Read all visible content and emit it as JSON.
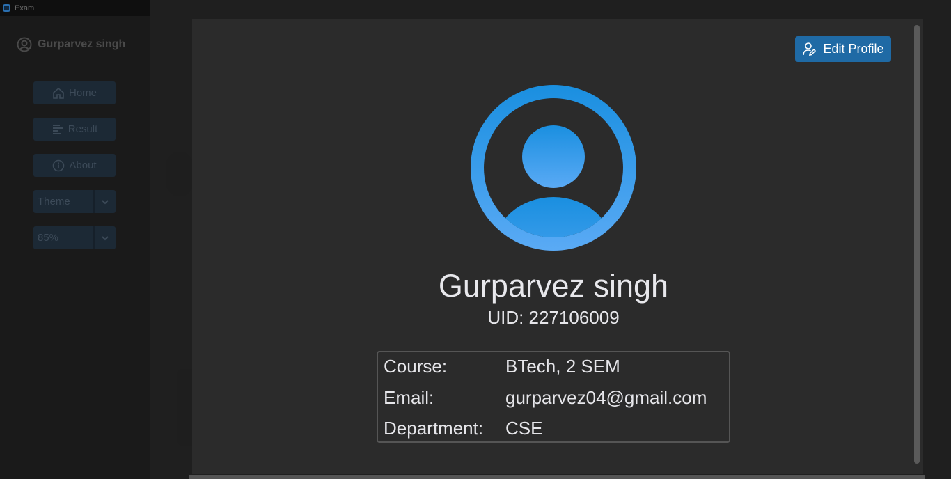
{
  "window": {
    "title": "Exam"
  },
  "sidebar": {
    "user_name": "Gurparvez singh",
    "nav": [
      {
        "label": "Home",
        "icon": "home-icon"
      },
      {
        "label": "Result",
        "icon": "chart-icon"
      },
      {
        "label": "About",
        "icon": "info-icon"
      }
    ],
    "theme_select": {
      "value": "Theme"
    },
    "scale_select": {
      "value": "85%"
    }
  },
  "profile": {
    "edit_button_label": "Edit Profile",
    "name": "Gurparvez singh",
    "uid": "UID: 227106009",
    "details": [
      {
        "key": "Course:",
        "value": "BTech, 2 SEM"
      },
      {
        "key": "Email:",
        "value": "gurparvez04@gmail.com"
      },
      {
        "key": "Department:",
        "value": "CSE"
      }
    ]
  },
  "colors": {
    "accent": "#1f6aa5",
    "avatar_top": "#1a8fe0",
    "avatar_bottom": "#5aaaf5",
    "modal_bg": "#2b2b2b",
    "text": "#e8e8ec"
  }
}
